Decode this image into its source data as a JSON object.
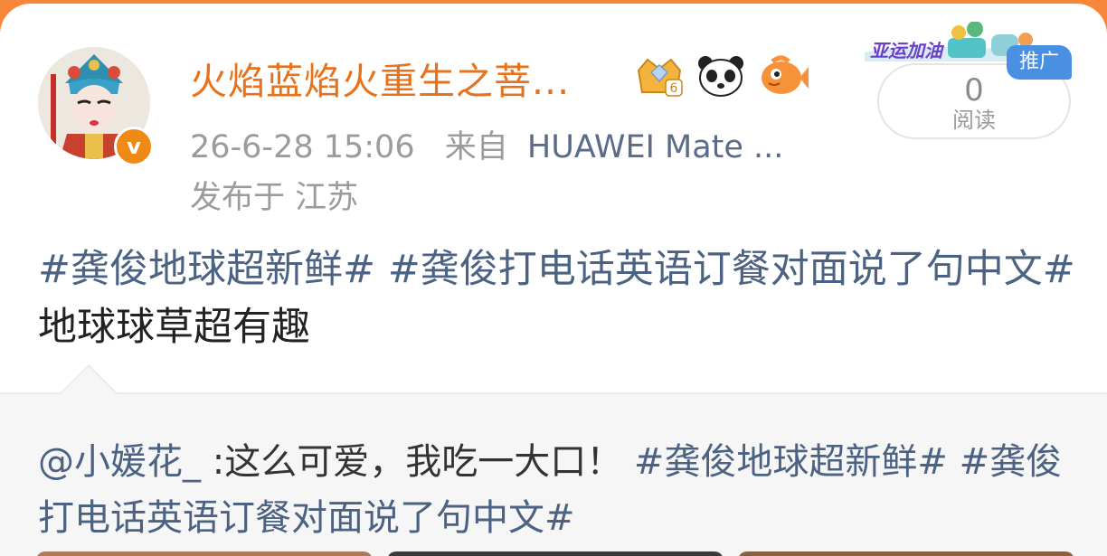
{
  "user": {
    "name": "火焰蓝焰火重生之菩...",
    "verified_label": "v",
    "badges": [
      {
        "icon": "crown-level-icon",
        "level": "6"
      },
      {
        "icon": "panda-icon"
      },
      {
        "icon": "fish-icon"
      }
    ]
  },
  "meta": {
    "datetime": "26-6-28 15:06",
    "source_prefix": "来自",
    "device": "HUAWEI Mate ...",
    "location": "发布于 江苏"
  },
  "promo": {
    "banner_text": "亚运加油",
    "ad_label": "推广",
    "read_count": "0",
    "read_label": "阅读"
  },
  "post": {
    "topic1": "#龚俊地球超新鲜#",
    "topic2": "#龚俊打电话英语订餐对面说了句中文#",
    "text": "地球球草超有趣"
  },
  "repost": {
    "mention": "@小媛花_",
    "text": ":这么可爱，我吃一大口！",
    "topic1": "#龚俊地球超新鲜#",
    "topic2": "#龚俊打电话英语订餐对面说了句中文#"
  },
  "colors": {
    "brand_orange": "#e8721b",
    "topic_blue": "#4c6283",
    "ad_blue": "#4a90e2"
  }
}
